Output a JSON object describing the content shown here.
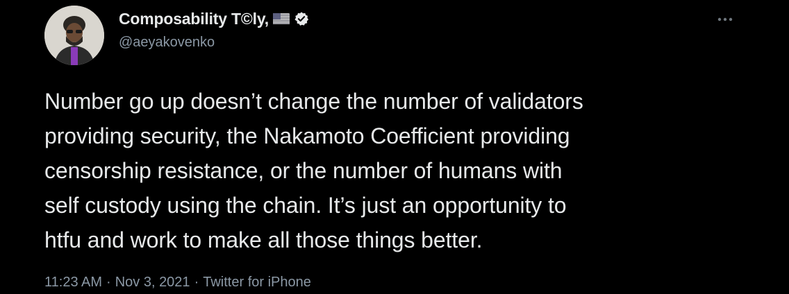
{
  "author": {
    "display_name": "Composability T©ly,",
    "handle": "@aeyakovenko",
    "avatar_icon": "person-avatar-icon",
    "flag_icon": "us-flag-icon",
    "verified_icon": "verified-badge-icon"
  },
  "tweet": {
    "text": "Number go up doesn’t change the number of validators\nproviding security, the Nakamoto Coefficient providing\ncensorship resistance, or the number of humans with\nself custody using the chain. It’s just an opportunity to\nhtfu and work to make all those things better."
  },
  "meta": {
    "time": "11:23 AM",
    "separator_1": "·",
    "date": "Nov 3, 2021",
    "separator_2": "·",
    "source": "Twitter for iPhone"
  },
  "more_menu_icon": "more-dots-icon",
  "colors": {
    "background": "#000000",
    "text_primary": "#e7e9ea",
    "text_secondary": "#8b98a5"
  }
}
